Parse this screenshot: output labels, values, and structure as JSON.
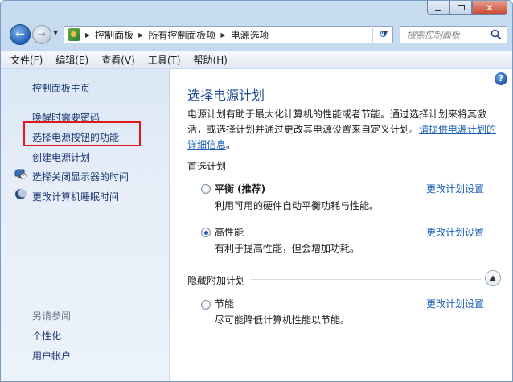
{
  "window": {
    "min_glyph": "",
    "max_glyph": "",
    "close_glyph": "✕"
  },
  "address": {
    "crumbs": [
      "控制面板",
      "所有控制面板项",
      "电源选项"
    ]
  },
  "search": {
    "placeholder": "搜索控制面板"
  },
  "menu": [
    "文件(F)",
    "编辑(E)",
    "查看(V)",
    "工具(T)",
    "帮助(H)"
  ],
  "sidebar": {
    "home": "控制面板主页",
    "links": [
      "唤醒时需要密码",
      "选择电源按钮的功能",
      "创建电源计划",
      "选择关闭显示器的时间",
      "更改计算机睡眠时间"
    ],
    "see_also_title": "另请参阅",
    "see_also": [
      "个性化",
      "用户帐户"
    ]
  },
  "main": {
    "title": "选择电源计划",
    "description": "电源计划有助于最大化计算机的性能或者节能。通过选择计划来将其激活，或选择计划并通过更改其电源设置来自定义计划。",
    "description_link": "请提供电源计划的详细信息",
    "description_end": "。",
    "preferred_section": "首选计划",
    "hidden_section": "隐藏附加计划",
    "plans": [
      {
        "name": "平衡 (推荐)",
        "desc": "利用可用的硬件自动平衡功耗与性能。",
        "link": "更改计划设置",
        "selected": false
      },
      {
        "name": "高性能",
        "desc": "有利于提高性能，但会增加功耗。",
        "link": "更改计划设置",
        "selected": true
      },
      {
        "name": "节能",
        "desc": "尽可能降低计算机性能以节能。",
        "link": "更改计划设置",
        "selected": false
      }
    ]
  },
  "icons": {
    "back": "back-arrow-icon",
    "forward": "forward-arrow-icon",
    "refresh": "refresh-icon",
    "search": "search-icon",
    "help": "help-icon",
    "collapse": "chevron-up-icon",
    "monitor": "monitor-clock-icon",
    "sleep": "moon-icon"
  },
  "colors": {
    "link": "#1a5fb4",
    "title": "#1e4a8c",
    "highlight_box": "#e01818",
    "sidebar_bg": "#dbe7f6"
  }
}
